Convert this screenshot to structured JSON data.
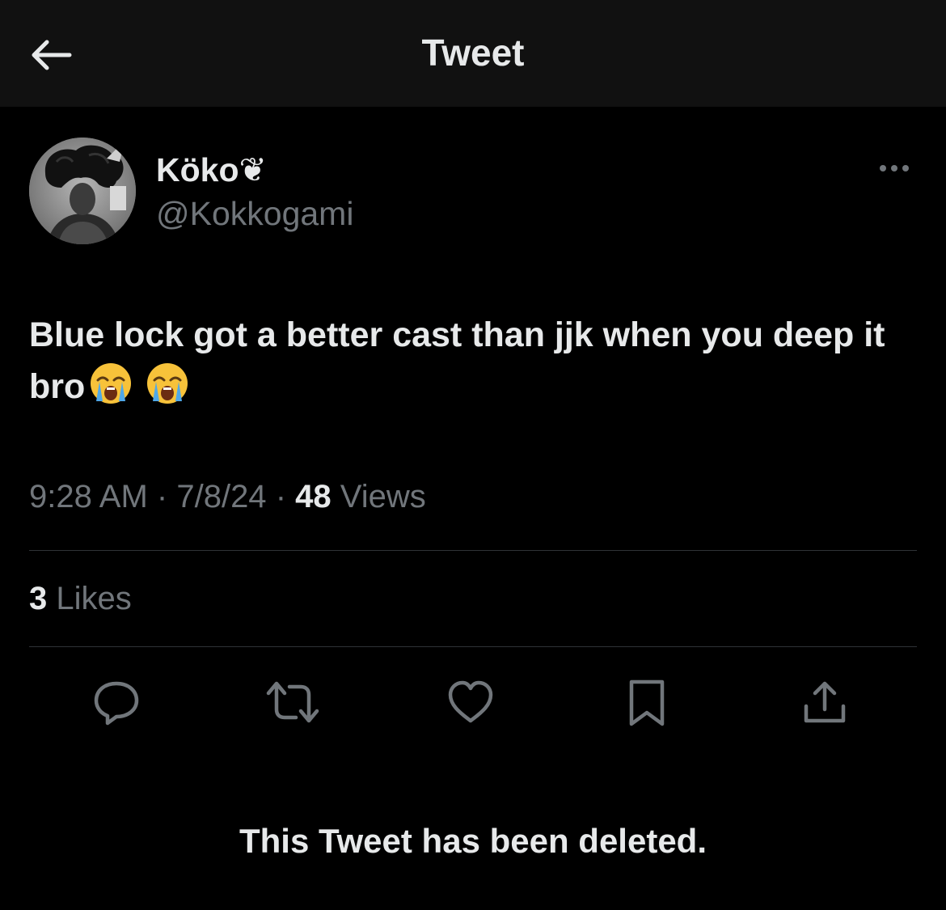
{
  "header": {
    "title": "Tweet",
    "back_icon": "arrow-left-icon"
  },
  "author": {
    "display_name": "Köko❦",
    "handle": "@Kokkogami",
    "avatar_icon": "profile-photo"
  },
  "tweet": {
    "text": "Blue lock got a better cast than jjk when you deep it bro",
    "emojis": [
      "😭",
      "😭"
    ],
    "emoji_icons": [
      "loudly-crying-face-icon",
      "loudly-crying-face-icon"
    ]
  },
  "meta": {
    "time": "9:28 AM",
    "separator": "·",
    "date": "7/8/24",
    "views_count": "48",
    "views_label": "Views"
  },
  "engagement": {
    "likes_count": "3",
    "likes_label": "Likes"
  },
  "actions": [
    "reply-icon",
    "retweet-icon",
    "like-icon",
    "bookmark-icon",
    "share-icon"
  ],
  "quoted_status": {
    "message": "This Tweet has been deleted."
  },
  "colors": {
    "background": "#000000",
    "header_bg": "#111111",
    "primary_text": "#e7e9ea",
    "secondary_text": "#71767b",
    "divider": "#2f3336"
  }
}
